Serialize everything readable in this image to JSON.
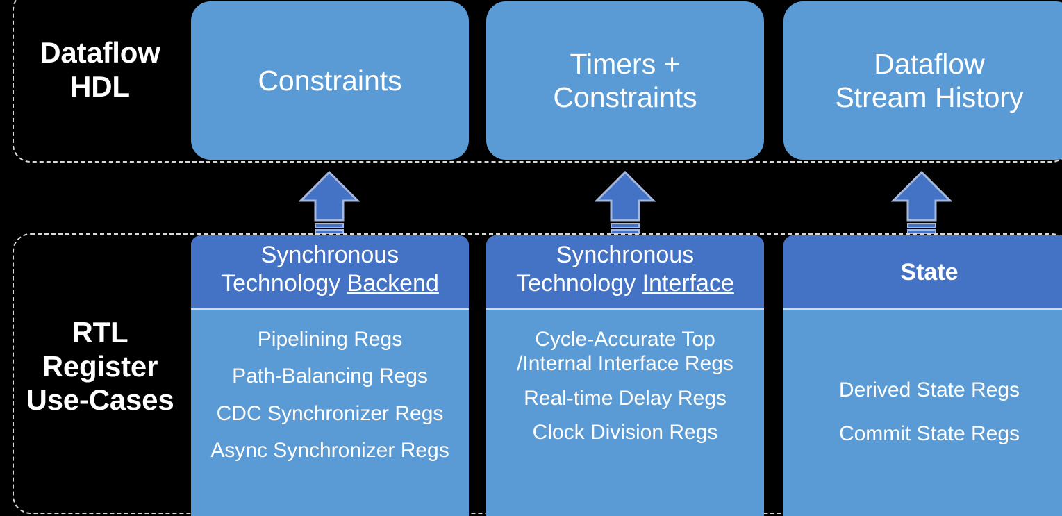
{
  "rows": {
    "top": {
      "label": "Dataflow\nHDL",
      "cards": [
        {
          "title": "Constraints"
        },
        {
          "title": "Timers +\nConstraints"
        },
        {
          "title": "Dataflow\nStream History"
        }
      ]
    },
    "bottom": {
      "label": "RTL\nRegister\nUse-Cases",
      "columns": [
        {
          "header_prefix": "Synchronous\nTechnology ",
          "header_emphasis": "Backend",
          "header_bold": false,
          "items": [
            "Pipelining Regs",
            "Path-Balancing Regs",
            "CDC Synchronizer Regs",
            "Async Synchronizer Regs"
          ]
        },
        {
          "header_prefix": "Synchronous\nTechnology ",
          "header_emphasis": "Interface",
          "header_bold": false,
          "items": [
            "Cycle-Accurate Top\n/Internal Interface Regs",
            "Real-time Delay Regs",
            "Clock Division Regs"
          ]
        },
        {
          "header_prefix": "",
          "header_emphasis": "State",
          "header_bold": true,
          "items": [
            "Derived State Regs",
            "Commit State Regs"
          ]
        }
      ]
    }
  },
  "arrows": [
    {
      "icon": "striped-up-arrow-icon"
    },
    {
      "icon": "striped-up-arrow-icon"
    },
    {
      "icon": "striped-up-arrow-icon"
    }
  ],
  "colors": {
    "background": "#000000",
    "card_light_blue": "#5B9BD5",
    "card_dark_blue": "#4472C4",
    "arrow_blue": "#4472C4",
    "arrow_outline": "#A6B8DC",
    "text_white": "#FFFFFF",
    "dashed_outline": "#D9D9D9"
  }
}
